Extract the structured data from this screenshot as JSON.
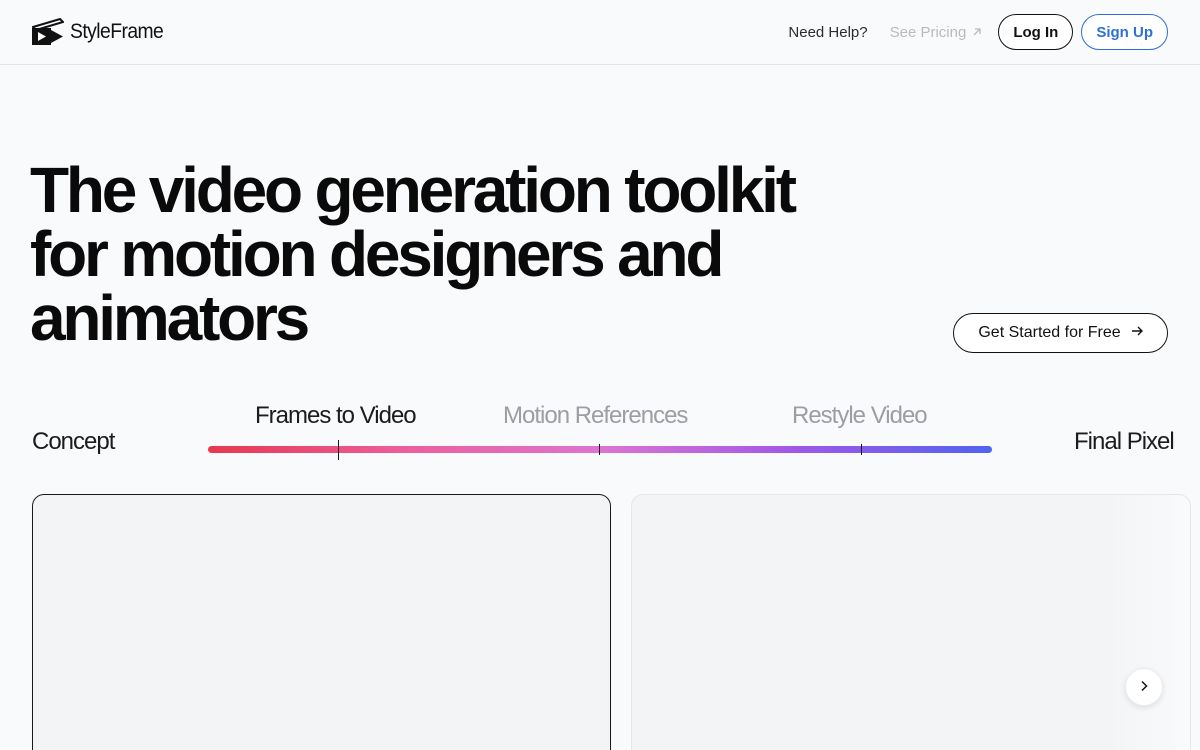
{
  "brand": {
    "name": "StyleFrame",
    "icon": "clapperboard-play-icon"
  },
  "nav": {
    "help": "Need Help?",
    "pricing": "See Pricing",
    "pricing_icon": "arrow-up-right-icon",
    "login": "Log In",
    "signup": "Sign Up"
  },
  "hero": {
    "title_lines": [
      "The video generation toolkit",
      "for motion designers and",
      "animators"
    ],
    "cta": "Get Started for Free",
    "cta_icon": "arrow-right-icon"
  },
  "timeline": {
    "start": "Concept",
    "end": "Final Pixel",
    "steps": [
      {
        "label": "Frames to Video",
        "active": true
      },
      {
        "label": "Motion References",
        "active": false
      },
      {
        "label": "Restyle Video",
        "active": false
      }
    ],
    "gradient": [
      "#e6394f",
      "#ec5f9b",
      "#dc74d1",
      "#9f58e7",
      "#5064ee"
    ]
  },
  "carousel": {
    "next_icon": "chevron-right-icon"
  },
  "colors": {
    "accent": "#2f6fd6",
    "text": "#0f0f10",
    "muted": "#9d9ea4"
  }
}
